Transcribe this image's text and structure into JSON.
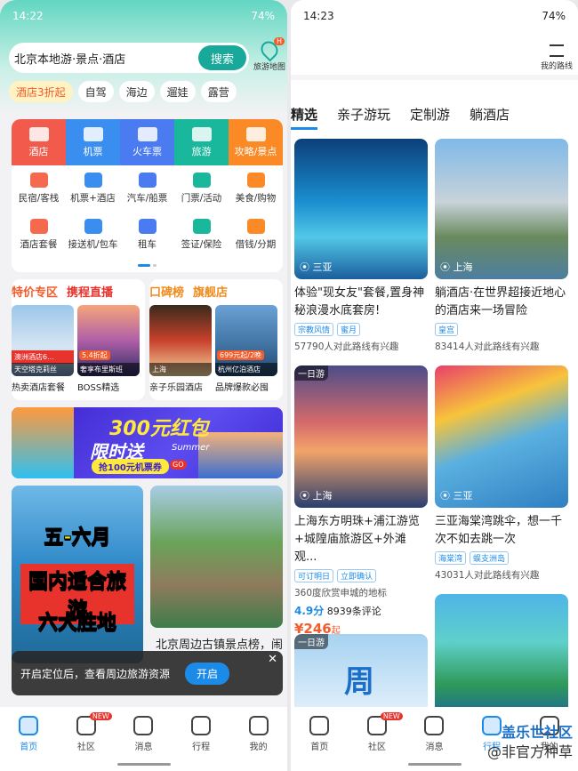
{
  "left": {
    "status": {
      "time": "14:22",
      "battery": "74%"
    },
    "search": {
      "placeholder": "北京本地游·景点·酒店",
      "button": "搜索"
    },
    "map_label": "旅游地图",
    "map_badge": "H",
    "chips": [
      "酒店3折起",
      "自驾",
      "海边",
      "遛娃",
      "露营"
    ],
    "top_grid": [
      {
        "label": "酒店",
        "color": "#f25b4b",
        "icon": "hotel-icon"
      },
      {
        "label": "机票",
        "color": "#3a8ef0",
        "icon": "plane-icon"
      },
      {
        "label": "火车票",
        "color": "#4a7bf0",
        "icon": "train-icon"
      },
      {
        "label": "旅游",
        "color": "#19b79b",
        "icon": "palm-icon"
      },
      {
        "label": "攻略/景点",
        "color": "#fb8a26",
        "icon": "book-icon"
      }
    ],
    "grid_rows": [
      [
        {
          "label": "民宿/客栈",
          "color": "#f56a4f",
          "icon": "house-icon"
        },
        {
          "label": "机票+酒店",
          "color": "#3a8ef0",
          "icon": "plane-hotel-icon"
        },
        {
          "label": "汽车/船票",
          "color": "#4a7bf0",
          "icon": "bus-icon"
        },
        {
          "label": "门票/活动",
          "color": "#19b79b",
          "icon": "ticket-icon"
        },
        {
          "label": "美食/购物",
          "color": "#fb8a26",
          "icon": "bag-icon"
        }
      ],
      [
        {
          "label": "酒店套餐",
          "color": "#f56a4f",
          "icon": "package-icon"
        },
        {
          "label": "接送机/包车",
          "color": "#3a8ef0",
          "icon": "car-icon"
        },
        {
          "label": "租车",
          "color": "#4a7bf0",
          "icon": "rental-car-icon"
        },
        {
          "label": "签证/保险",
          "color": "#19b79b",
          "icon": "shield-icon"
        },
        {
          "label": "借钱/分期",
          "color": "#fb8a26",
          "icon": "money-bag-icon"
        }
      ]
    ],
    "promo_left": {
      "title1": "特价专区",
      "title2": "携程直播",
      "items": [
        {
          "tag": "",
          "caption": "澳洲酒店6...",
          "sub": "天空塔克莉丝",
          "label": "热卖酒店套餐"
        },
        {
          "tag": "5.4折起",
          "caption": "奢享布里斯班",
          "sub": "",
          "label": "BOSS精选"
        }
      ]
    },
    "promo_right": {
      "title1": "口碑榜",
      "title2": "旗舰店",
      "items": [
        {
          "tag": "",
          "caption": "上海",
          "sub": "",
          "label": "亲子乐园酒店"
        },
        {
          "tag": "699元起/2晚",
          "caption": "杭州亿泊酒店",
          "sub": "",
          "label": "品牌爆款必囤"
        }
      ]
    },
    "banner": {
      "line1": "300元红包",
      "line2": "限时送",
      "line3": "抢100元机票券",
      "go": "GO",
      "summer": "Summer"
    },
    "feed": {
      "card1_lines": [
        "五-六月",
        "国内适合旅游",
        "六大胜地"
      ],
      "card1_caption": "六大胜地",
      "card2_caption": "北京周边古镇景点榜，闹"
    },
    "toast": {
      "text": "开启定位后，查看周边旅游资源",
      "button": "开启"
    },
    "tabs": [
      {
        "label": "首页",
        "active": true,
        "icon": "home-icon"
      },
      {
        "label": "社区",
        "active": false,
        "icon": "community-icon",
        "badge": "NEW"
      },
      {
        "label": "消息",
        "active": false,
        "icon": "message-icon"
      },
      {
        "label": "行程",
        "active": false,
        "icon": "calendar-icon"
      },
      {
        "label": "我的",
        "active": false,
        "icon": "diamond-icon"
      }
    ]
  },
  "right": {
    "status": {
      "time": "14:23",
      "battery": "74%"
    },
    "filter_label": "我的路线",
    "tabs": [
      "精选",
      "亲子游玩",
      "定制游",
      "躺酒店"
    ],
    "cards": [
      {
        "location": "三亚",
        "ribbon": "",
        "title": "体验\"现女友\"套餐,置身神秘浪漫水底套房!",
        "tags": [
          "宗教风情",
          "蜜月"
        ],
        "sub": "57790人对此路线有兴趣",
        "rating": "",
        "reviews": "",
        "price": ""
      },
      {
        "location": "上海",
        "ribbon": "",
        "title": "躺酒店·在世界超接近地心的酒店来一场冒险",
        "tags": [
          "皇宫"
        ],
        "sub": "83414人对此路线有兴趣",
        "rating": "",
        "reviews": "",
        "price": ""
      },
      {
        "location": "上海",
        "ribbon": "一日游",
        "title": "上海东方明珠+浦江游览+城隍庙旅游区+外滩观...",
        "tags": [
          "可订明日",
          "立即确认"
        ],
        "sub": "360度欣赏申城的地标",
        "rating": "4.9分",
        "reviews": "8939条评论",
        "price": "¥246",
        "price_suffix": "起"
      },
      {
        "location": "三亚",
        "ribbon": "",
        "title": "三亚海棠湾跳伞，想一千次不如去跳一次",
        "tags": [
          "海棠湾",
          "蜈支洲岛"
        ],
        "sub": "43031人对此路线有兴趣",
        "rating": "",
        "reviews": "",
        "price": ""
      },
      {
        "location": "",
        "ribbon": "一日游",
        "title": "",
        "tags": [],
        "sub": "",
        "rating": "",
        "reviews": "",
        "price": "",
        "glyph": "周"
      }
    ],
    "tabs_bottom": [
      {
        "label": "首页",
        "active": false,
        "icon": "home-icon"
      },
      {
        "label": "社区",
        "active": false,
        "icon": "community-icon",
        "badge": "NEW"
      },
      {
        "label": "消息",
        "active": false,
        "icon": "message-icon"
      },
      {
        "label": "行程",
        "active": true,
        "icon": "calendar-icon"
      },
      {
        "label": "我的",
        "active": false,
        "icon": "diamond-icon"
      }
    ],
    "watermark": [
      "盖乐世社区",
      "@非官方种草"
    ]
  }
}
